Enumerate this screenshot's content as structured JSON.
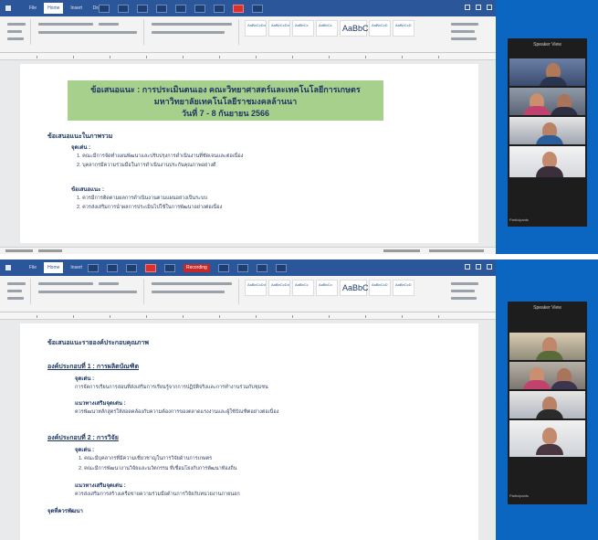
{
  "screenshots": [
    {
      "word": {
        "tabs": [
          "File",
          "Home",
          "Insert",
          "Draw",
          "Design",
          "Layout",
          "References",
          "Mailings",
          "Review",
          "View",
          "Help"
        ],
        "active_tab": "Home",
        "recording_label": "",
        "style_sample": "AaBbC"
      },
      "document": {
        "banner_line1": "ข้อเสนอแนะ : การประเมินตนเอง คณะวิทยาศาสตร์และเทคโนโลยีการเกษตร",
        "banner_line2": "มหาวิทยาลัยเทคโนโลยีราชมงคลล้านนา",
        "banner_line3": "วันที่ 7 - 8 กันยายน 2566",
        "section_heading": "ข้อเสนอแนะในภาพรวม",
        "strengths_label": "จุดเด่น :",
        "strengths": [
          "1. คณะมีการจัดทำแผนพัฒนาและปรับปรุงการดำเนินงานที่ชัดเจนและต่อเนื่อง",
          "2. บุคลากรมีความร่วมมือในการดำเนินงานประกันคุณภาพอย่างดี"
        ],
        "improve_label": "ข้อเสนอแนะ :",
        "improvements": [
          "1. ควรมีการติดตามผลการดำเนินงานตามแผนอย่างเป็นระบบ",
          "2. ควรส่งเสริมการนำผลการประเมินไปใช้ในการพัฒนาอย่างต่อเนื่อง"
        ]
      },
      "zoom": {
        "panel_title": "Speaker View",
        "participants": [
          "",
          "",
          "",
          ""
        ],
        "footer": "Participants"
      }
    },
    {
      "word": {
        "tabs": [
          "File",
          "Home",
          "Insert",
          "Draw",
          "Design",
          "Layout",
          "References",
          "Mailings",
          "Review",
          "View",
          "Help"
        ],
        "active_tab": "Home",
        "recording_label": "Recording",
        "style_sample": "AaBbC"
      },
      "document": {
        "section_heading": "ข้อเสนอแนะรายองค์ประกอบคุณภาพ",
        "comp1_title": "องค์ประกอบที่ 1 : การผลิตบัณฑิต",
        "comp1_strength_label": "จุดเด่น :",
        "comp1_strength": "การจัดการเรียนการสอนที่ส่งเสริมการเรียนรู้จากการปฏิบัติจริงและการทำงานร่วมกับชุมชน",
        "comp1_improve_label": "แนวทางเสริมจุดเด่น :",
        "comp1_improve": "ควรพัฒนาหลักสูตรให้สอดคล้องกับความต้องการของตลาดแรงงานและผู้ใช้บัณฑิตอย่างต่อเนื่อง",
        "comp2_title": "องค์ประกอบที่ 2 : การวิจัย",
        "comp2_strength_label": "จุดเด่น :",
        "comp2_strengths": [
          "1. คณะมีบุคลากรที่มีความเชี่ยวชาญในการวิจัยด้านการเกษตร",
          "2. คณะมีการพัฒนางานวิจัยและนวัตกรรม ที่เชื่อมโยงกับการพัฒนาท้องถิ่น"
        ],
        "comp2_improve_label": "แนวทางเสริมจุดเด่น :",
        "comp2_improve": "ควรส่งเสริมการสร้างเครือข่ายความร่วมมือด้านการวิจัยกับหน่วยงานภายนอก",
        "footer_label": "จุดที่ควรพัฒนา"
      },
      "zoom": {
        "panel_title": "Speaker View",
        "participants": [
          "",
          "",
          "",
          ""
        ],
        "footer": "Participants"
      }
    }
  ]
}
